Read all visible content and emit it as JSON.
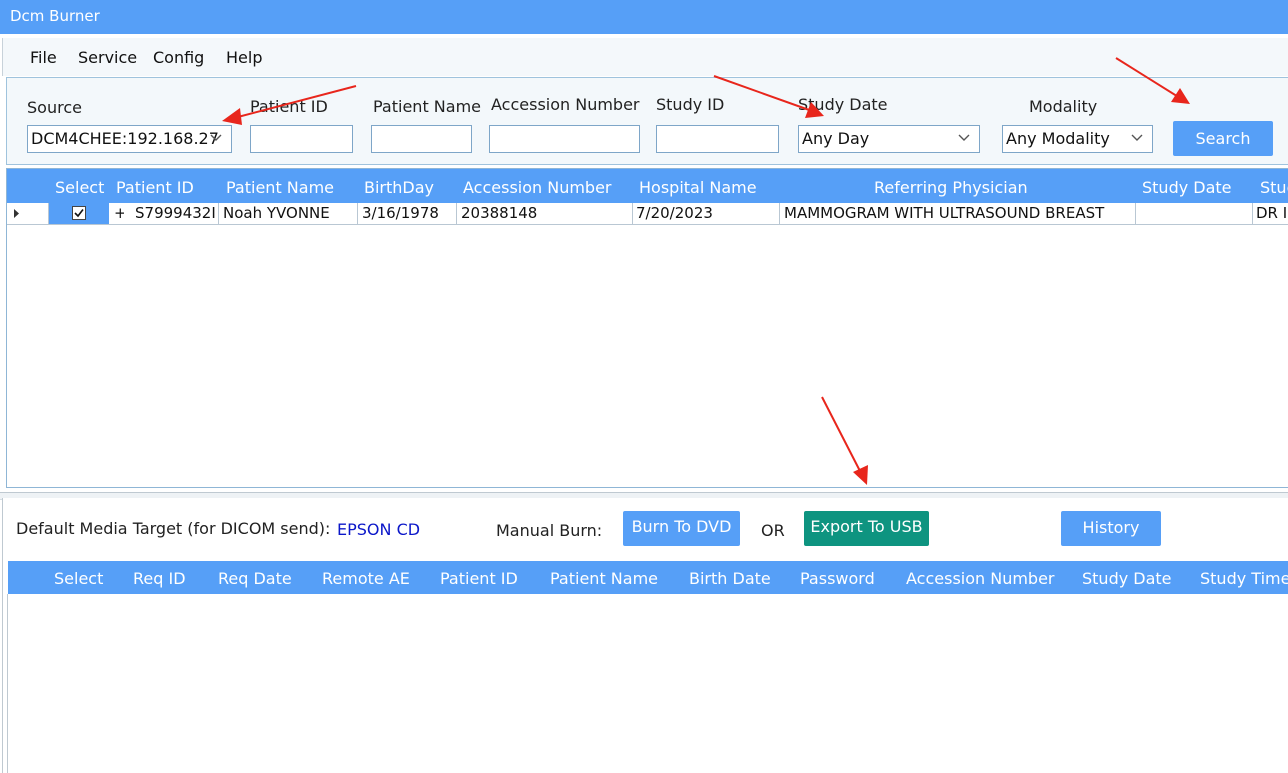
{
  "window": {
    "title": "Dcm Burner"
  },
  "menu": {
    "items": [
      "File",
      "Service",
      "Config",
      "Help"
    ]
  },
  "filters": {
    "source_label": "Source",
    "source_value": "DCM4CHEE:192.168.27",
    "patient_id_label": "Patient ID",
    "patient_name_label": "Patient Name",
    "accession_label": "Accession Number",
    "study_id_label": "Study ID",
    "study_date_label": "Study Date",
    "study_date_value": "Any Day",
    "modality_label": "Modality",
    "modality_value": "Any Modality",
    "search_button": "Search"
  },
  "study_table": {
    "headers": [
      "Select",
      "Patient ID",
      "Patient Name",
      "BirthDay",
      "Accession Number",
      "Hospital Name",
      "Referring Physician",
      "Study Date",
      "Stuc"
    ],
    "rows": [
      {
        "selected": true,
        "expand": "+",
        "patient_id": "S7999432I",
        "patient_name": "Noah YVONNE",
        "birthday": "3/16/1978",
        "accession": "20388148",
        "hospital": "7/20/2023",
        "physician": "MAMMOGRAM WITH ULTRASOUND BREAST",
        "study_date": "",
        "extra": "DR I"
      }
    ]
  },
  "burn": {
    "target_label": "Default Media Target (for DICOM send):",
    "target_value": "EPSON CD",
    "manual_label": "Manual Burn:",
    "burn_dvd_button": "Burn To DVD",
    "or_label": "OR",
    "export_usb_button": "Export To USB",
    "history_button": "History"
  },
  "request_table": {
    "headers": [
      "Select",
      "Req ID",
      "Req Date",
      "Remote AE",
      "Patient ID",
      "Patient Name",
      "Birth Date",
      "Password",
      "Accession Number",
      "Study Date",
      "Study Time"
    ]
  },
  "colors": {
    "accent": "#569ff7",
    "export_button": "#0e9480",
    "target_value": "#0b17c9",
    "annotation_arrow": "#e8261c"
  }
}
